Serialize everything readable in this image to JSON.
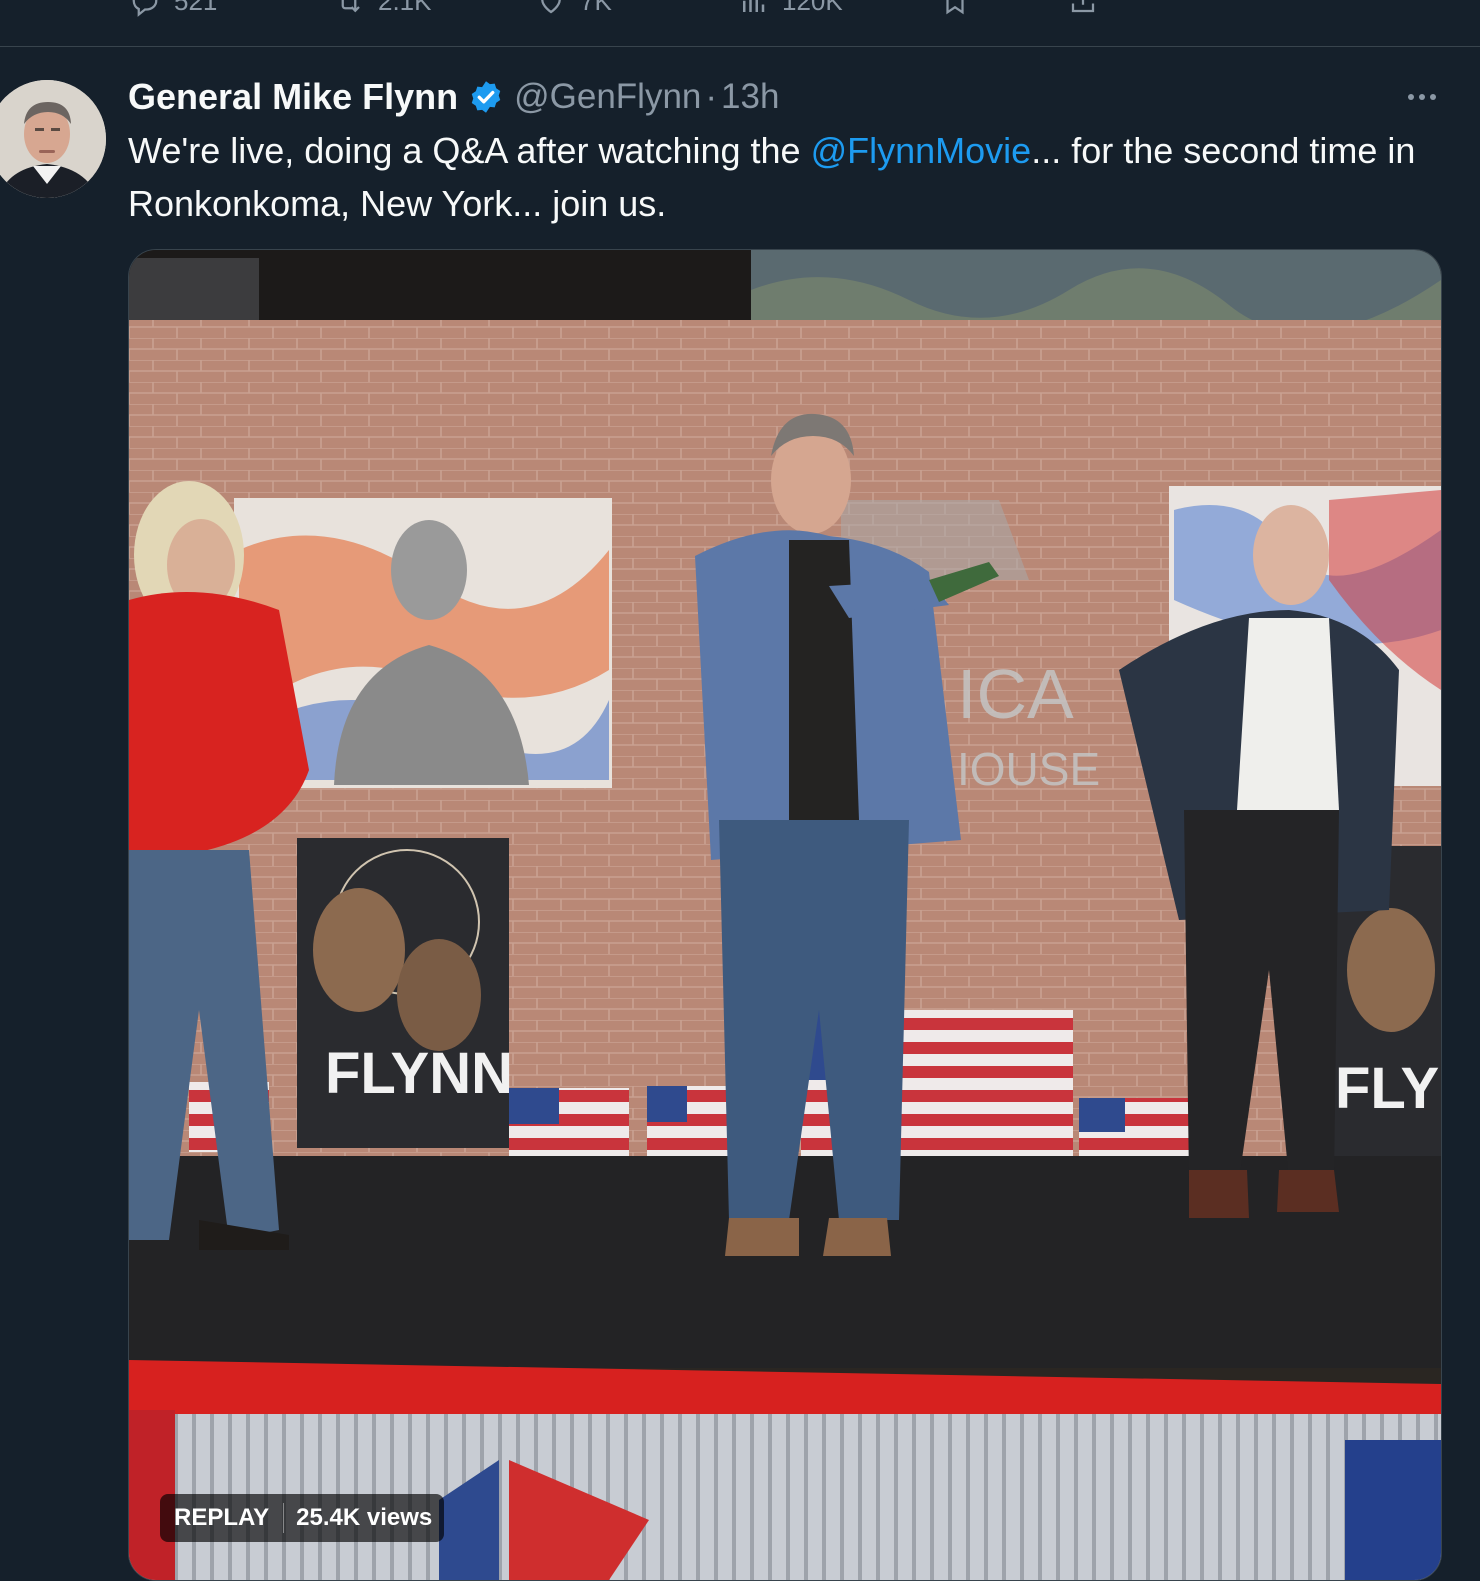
{
  "previous_tweet": {
    "actions": [
      {
        "icon": "reply-icon",
        "count": "521"
      },
      {
        "icon": "retweet-icon",
        "count": "2.1K"
      },
      {
        "icon": "like-icon",
        "count": "7K"
      },
      {
        "icon": "views-icon",
        "count": "120K"
      },
      {
        "icon": "bookmark-icon",
        "count": ""
      },
      {
        "icon": "share-icon",
        "count": ""
      }
    ]
  },
  "tweet": {
    "display_name": "General Mike Flynn",
    "verified": true,
    "handle": "@GenFlynn",
    "separator": "·",
    "time": "13h",
    "text_before": "We're live, doing a Q&A after watching the ",
    "mention": "@FlynnMovie",
    "text_after": "... for the second time in Ronkonkoma, New York... join us.",
    "media": {
      "badge_replay": "REPLAY",
      "badge_views": "25.4K views",
      "poster_left_title": "FLYNN",
      "poster_right_title": "FLY",
      "backdrop_sign": "THE AMERICA FIRST HOUSE"
    }
  },
  "colors": {
    "background": "#15202b",
    "text": "#f7f9f9",
    "secondary": "#8b98a5",
    "accent": "#1d9bf0",
    "border": "#38444d"
  }
}
